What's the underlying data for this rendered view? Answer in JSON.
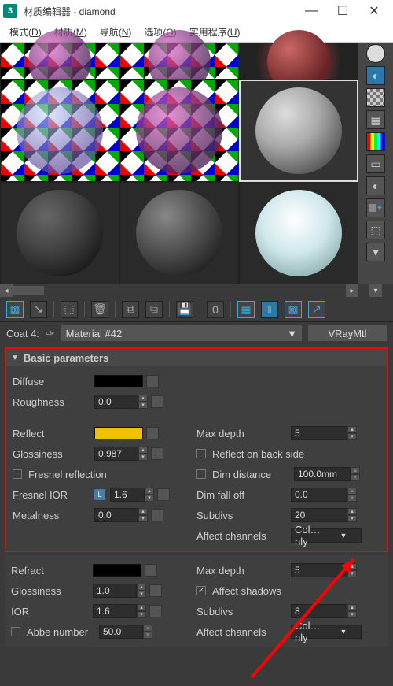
{
  "window": {
    "title": "材质编辑器 - diamond",
    "app_glyph": "3"
  },
  "menubar": {
    "items": [
      {
        "label": "模式",
        "key": "D"
      },
      {
        "label": "材质",
        "key": "M"
      },
      {
        "label": "导航",
        "key": "N"
      },
      {
        "label": "选项",
        "key": "O"
      },
      {
        "label": "实用程序",
        "key": "U"
      }
    ]
  },
  "toolbar": {
    "zero": "0"
  },
  "info": {
    "coat_label": "Coat 4:",
    "material_name": "Material #42",
    "material_type": "VRayMtl"
  },
  "basic": {
    "title": "Basic parameters",
    "diffuse_label": "Diffuse",
    "roughness_label": "Roughness",
    "roughness_value": "0.0",
    "reflect_label": "Reflect",
    "glossiness_label": "Glossiness",
    "glossiness_value": "0.987",
    "fresnel_label": "Fresnel reflection",
    "fresnel_ior_label": "Fresnel IOR",
    "fresnel_ior_value": "1.6",
    "metalness_label": "Metalness",
    "metalness_value": "0.0",
    "max_depth_label": "Max depth",
    "max_depth_value": "5",
    "back_side_label": "Reflect on back side",
    "dim_distance_label": "Dim distance",
    "dim_distance_value": "100.0mm",
    "dim_falloff_label": "Dim fall off",
    "dim_falloff_value": "0.0",
    "subdivs_label": "Subdivs",
    "subdivs_value": "20",
    "affect_label": "Affect channels",
    "affect_value": "Col…nly"
  },
  "refract": {
    "refract_label": "Refract",
    "glossiness_label": "Glossiness",
    "glossiness_value": "1.0",
    "ior_label": "IOR",
    "ior_value": "1.6",
    "abbe_label": "Abbe number",
    "abbe_value": "50.0",
    "max_depth_label": "Max depth",
    "max_depth_value": "5",
    "affect_shadows_label": "Affect shadows",
    "subdivs_label": "Subdivs",
    "subdivs_value": "8",
    "affect_label": "Affect channels",
    "affect_value": "Col…nly"
  }
}
